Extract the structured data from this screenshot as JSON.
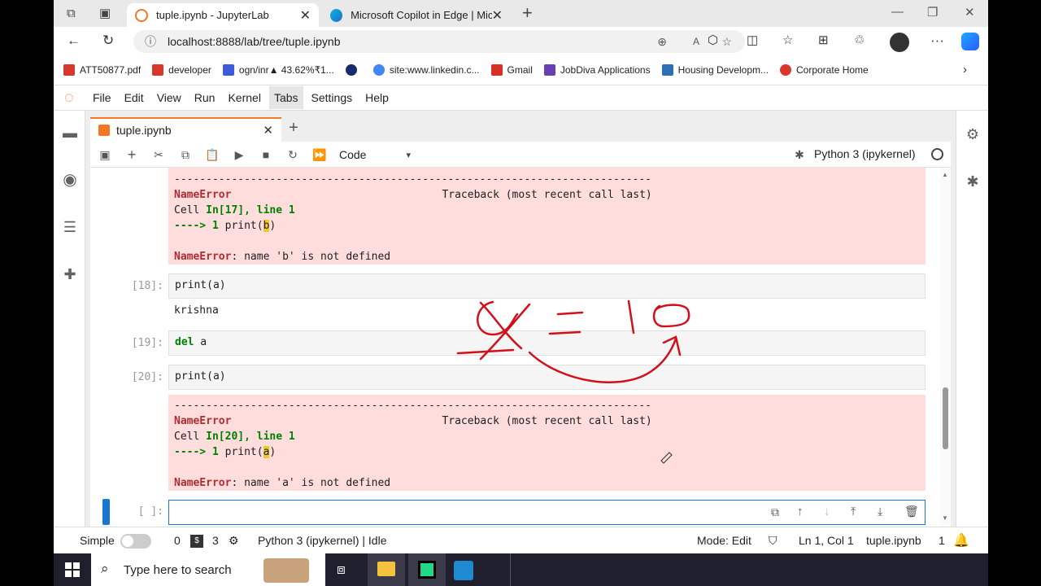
{
  "browser": {
    "tabs": [
      {
        "title": "tuple.ipynb - JupyterLab",
        "active": true
      },
      {
        "title": "Microsoft Copilot in Edge | Micro",
        "active": false
      }
    ],
    "new_tab": "+",
    "url": "localhost:8888/lab/tree/tuple.ipynb",
    "bookmarks": [
      {
        "label": "ATT50877.pdf",
        "color": "#d9372b"
      },
      {
        "label": "developer",
        "color": "#d9372b"
      },
      {
        "label": "ogn/inr▲ 43.62%₹1...",
        "color": "#3b5bdb"
      },
      {
        "label": "",
        "color": "#1a2a6c"
      },
      {
        "label": "site:www.linkedin.c...",
        "color": "#4285f4"
      },
      {
        "label": "Gmail",
        "color": "#d93025"
      },
      {
        "label": "JobDiva Applications",
        "color": "#6a3fb5"
      },
      {
        "label": "Housing Developm...",
        "color": "#2c6fb7"
      },
      {
        "label": "Corporate Home",
        "color": "#d9372b"
      }
    ]
  },
  "jupyter": {
    "menus": [
      "File",
      "Edit",
      "View",
      "Run",
      "Kernel",
      "Tabs",
      "Settings",
      "Help"
    ],
    "notebook_tab": "tuple.ipynb",
    "cell_type": "Code",
    "kernel": "Python 3 (ipykernel)",
    "cells": {
      "err17": {
        "dashes": "---------------------------------------------------------------------------",
        "ename": "NameError",
        "traceback": "Traceback (most recent call last)",
        "cell_prefix": "Cell ",
        "cell_ref": "In[17], line 1",
        "arrow": "----> 1 ",
        "code_pre": "print(",
        "var": "b",
        "code_post": ")",
        "msg_name": "NameError",
        "msg": ": name 'b' is not defined"
      },
      "c18": {
        "prompt": "[18]:",
        "code": "print(a)",
        "output": "krishna"
      },
      "c19": {
        "prompt": "[19]:",
        "kw": "del",
        "code": " a"
      },
      "c20": {
        "prompt": "[20]:",
        "code": "print(a)"
      },
      "err20": {
        "dashes": "---------------------------------------------------------------------------",
        "ename": "NameError",
        "traceback": "Traceback (most recent call last)",
        "cell_prefix": "Cell ",
        "cell_ref": "In[20], line 1",
        "arrow": "----> 1 ",
        "code_pre": "print(",
        "var": "a",
        "code_post": ")",
        "msg_name": "NameError",
        "msg": ": name 'a' is not defined"
      },
      "empty": {
        "prompt": "[ ]:"
      }
    },
    "status": {
      "simple": "Simple",
      "count0": "0",
      "count3": "3",
      "kernel_status": "Python 3 (ipykernel) | Idle",
      "mode": "Mode: Edit",
      "position": "Ln 1, Col 1",
      "file": "tuple.ipynb",
      "notifications": "1"
    }
  },
  "taskbar": {
    "search_placeholder": "Type here to search"
  },
  "colors": {
    "jupyter_orange": "#f37726",
    "error_bg": "#fdd",
    "annotation_red": "#d0101a"
  }
}
